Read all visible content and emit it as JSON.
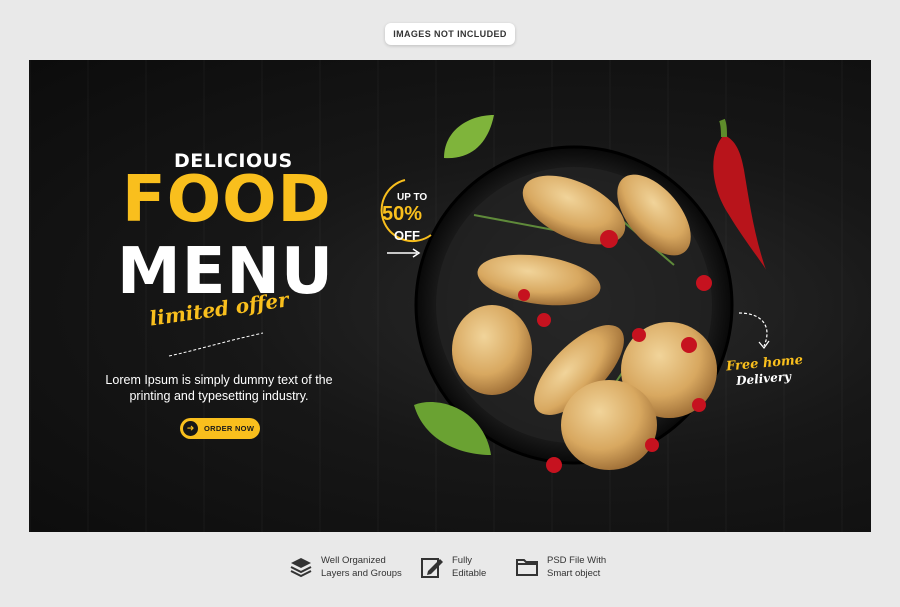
{
  "top_badge": "IMAGES NOT INCLUDED",
  "banner": {
    "eyebrow": "DELICIOUS",
    "headline_1": "FOOD",
    "headline_2": "MENU",
    "script_tagline": "limited offer",
    "body": "Lorem Ipsum is simply dummy text of the printing and typesetting industry.",
    "cta_label": "ORDER NOW",
    "offer": {
      "up_to": "UP TO",
      "percent": "50%",
      "off": "OFF"
    },
    "delivery": {
      "line1": "Free home",
      "line2": "Delivery"
    }
  },
  "features": [
    {
      "icon": "layers-icon",
      "line1": "Well Organized",
      "line2": "Layers and Groups"
    },
    {
      "icon": "edit-icon",
      "line1": "Fully",
      "line2": "Editable"
    },
    {
      "icon": "folder-icon",
      "line1": "PSD File With",
      "line2": "Smart object"
    }
  ],
  "colors": {
    "accent": "#f9bf1d",
    "banner_bg": "#141414",
    "page_bg": "#e9e9e9"
  }
}
